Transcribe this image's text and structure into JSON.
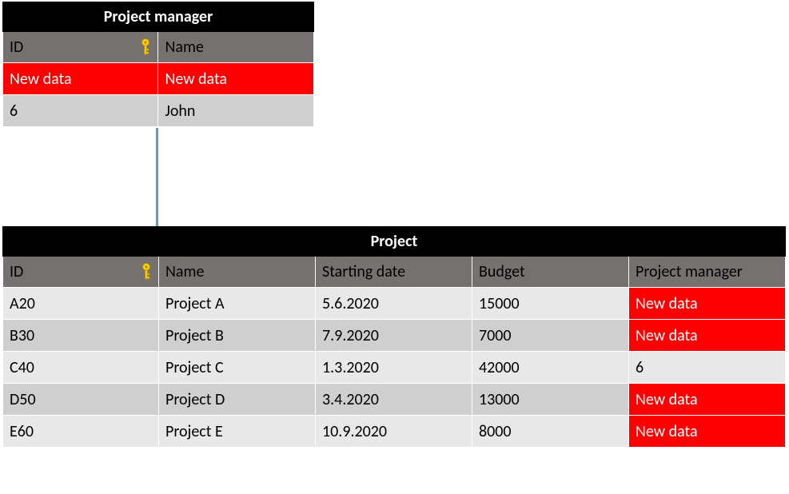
{
  "pm_table": {
    "title": "Project manager",
    "columns": [
      "ID",
      "Name"
    ],
    "rows": [
      {
        "cells": [
          "New data",
          "New data"
        ],
        "highlight": [
          true,
          true
        ],
        "shade": "light"
      },
      {
        "cells": [
          "6",
          "John"
        ],
        "highlight": [
          false,
          false
        ],
        "shade": "dark"
      }
    ]
  },
  "project_table": {
    "title": "Project",
    "columns": [
      "ID",
      "Name",
      "Starting date",
      "Budget",
      "Project manager"
    ],
    "rows": [
      {
        "cells": [
          "A20",
          "Project A",
          "5.6.2020",
          "15000",
          "New data"
        ],
        "highlight": [
          false,
          false,
          false,
          false,
          true
        ],
        "shade": "light"
      },
      {
        "cells": [
          "B30",
          "Project B",
          "7.9.2020",
          "7000",
          "New data"
        ],
        "highlight": [
          false,
          false,
          false,
          false,
          true
        ],
        "shade": "dark"
      },
      {
        "cells": [
          "C40",
          "Project C",
          "1.3.2020",
          "42000",
          "6"
        ],
        "highlight": [
          false,
          false,
          false,
          false,
          false
        ],
        "shade": "light"
      },
      {
        "cells": [
          "D50",
          "Project D",
          "3.4.2020",
          "13000",
          "New data"
        ],
        "highlight": [
          false,
          false,
          false,
          false,
          true
        ],
        "shade": "dark"
      },
      {
        "cells": [
          "E60",
          "Project E",
          "10.9.2020",
          "8000",
          "New data"
        ],
        "highlight": [
          false,
          false,
          false,
          false,
          true
        ],
        "shade": "light"
      }
    ]
  }
}
